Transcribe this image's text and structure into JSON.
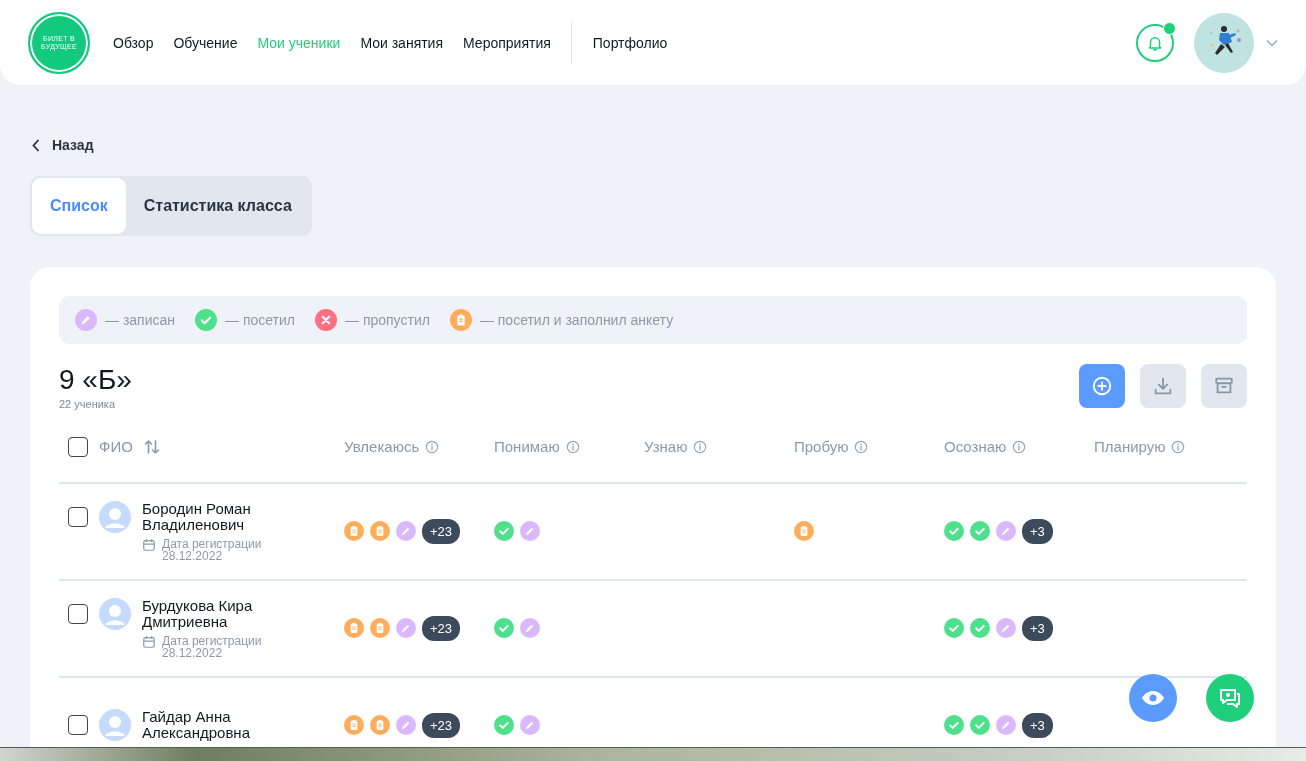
{
  "header": {
    "logo": [
      "БИЛЕТ В",
      "БУДУЩЕЕ"
    ],
    "nav": [
      {
        "label": "Обзор",
        "selected": false
      },
      {
        "label": "Обучение",
        "selected": false
      },
      {
        "label": "Мои ученики",
        "selected": true
      },
      {
        "label": "Мои занятия",
        "selected": false
      },
      {
        "label": "Мероприятия",
        "selected": false
      },
      {
        "label": "Портфолио",
        "selected": false
      }
    ],
    "notifications": {
      "unread": true
    }
  },
  "back": "Назад",
  "tabs": [
    {
      "label": "Список",
      "selected": true
    },
    {
      "label": "Статистика класса",
      "selected": false
    }
  ],
  "legend": [
    {
      "kind": "enrolled",
      "label": "— записан"
    },
    {
      "kind": "visited",
      "label": "— посетил"
    },
    {
      "kind": "missed",
      "label": "— пропустил"
    },
    {
      "kind": "survey",
      "label": "— посетил и заполнил анкету"
    }
  ],
  "class": {
    "title": "9 «Б»",
    "count": "22 ученика"
  },
  "actions": [
    {
      "kind": "add"
    },
    {
      "kind": "download"
    },
    {
      "kind": "archive"
    }
  ],
  "table": {
    "select_all_checked": false,
    "columns": [
      "ФИО",
      "Увлекаюсь",
      "Понимаю",
      "Узнаю",
      "Пробую",
      "Осознаю",
      "Планирую"
    ],
    "rows": [
      {
        "name": "Бородин Роман Владиленович",
        "date_label": "Дата регистрации",
        "date": "28.12.2022",
        "checked": false,
        "cells": [
          {
            "marks": [
              {
                "kind": "survey"
              },
              {
                "kind": "survey"
              },
              {
                "kind": "enrolled"
              }
            ],
            "more": "+23"
          },
          {
            "marks": [
              {
                "kind": "visited"
              },
              {
                "kind": "enrolled"
              }
            ]
          },
          {},
          {
            "marks": [
              {
                "kind": "survey"
              }
            ]
          },
          {
            "marks": [
              {
                "kind": "visited"
              },
              {
                "kind": "visited"
              },
              {
                "kind": "enrolled"
              }
            ],
            "more": "+3"
          },
          {}
        ]
      },
      {
        "name": "Бурдукова Кира Дмитриевна",
        "date_label": "Дата регистрации",
        "date": "28.12.2022",
        "checked": false,
        "cells": [
          {
            "marks": [
              {
                "kind": "survey"
              },
              {
                "kind": "survey"
              },
              {
                "kind": "enrolled"
              }
            ],
            "more": "+23"
          },
          {
            "marks": [
              {
                "kind": "visited"
              },
              {
                "kind": "enrolled"
              }
            ]
          },
          {},
          {},
          {
            "marks": [
              {
                "kind": "visited"
              },
              {
                "kind": "visited"
              },
              {
                "kind": "enrolled"
              }
            ],
            "more": "+3"
          },
          {}
        ]
      },
      {
        "name": "Гайдар Анна Александровна",
        "checked": false,
        "cells": [
          {
            "marks": [
              {
                "kind": "survey"
              },
              {
                "kind": "survey"
              },
              {
                "kind": "enrolled"
              }
            ],
            "more": "+23"
          },
          {
            "marks": [
              {
                "kind": "visited"
              },
              {
                "kind": "enrolled"
              }
            ]
          },
          {},
          {},
          {
            "marks": [
              {
                "kind": "visited"
              },
              {
                "kind": "visited"
              },
              {
                "kind": "enrolled"
              }
            ],
            "more": "+3"
          },
          {}
        ]
      }
    ]
  }
}
